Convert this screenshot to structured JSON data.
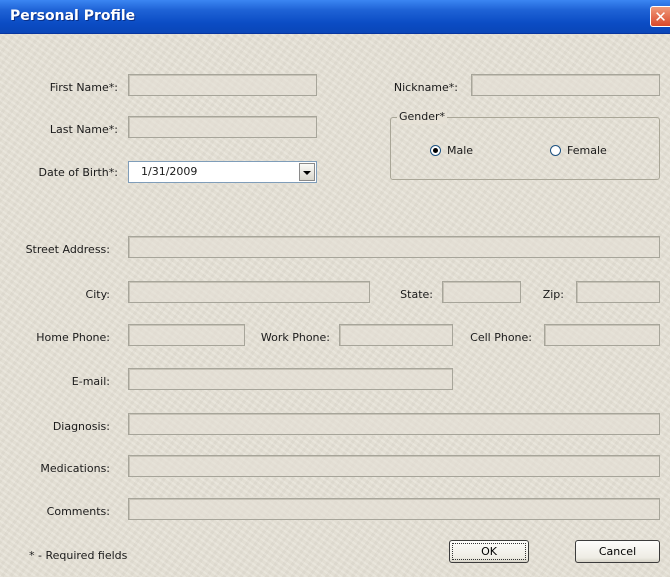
{
  "window": {
    "title": "Personal Profile",
    "close_glyph": "✕"
  },
  "form": {
    "first_name_label": "First Name*:",
    "last_name_label": "Last Name*:",
    "dob_label": "Date of Birth*:",
    "dob_value": "1/31/2009",
    "nickname_label": "Nickname*:",
    "gender_legend": "Gender*",
    "gender_male": "Male",
    "gender_female": "Female",
    "gender_selected": "Male",
    "street_label": "Street Address:",
    "city_label": "City:",
    "state_label": "State:",
    "zip_label": "Zip:",
    "home_phone_label": "Home Phone:",
    "work_phone_label": "Work Phone:",
    "cell_phone_label": "Cell Phone:",
    "email_label": "E-mail:",
    "diagnosis_label": "Diagnosis:",
    "medications_label": "Medications:",
    "comments_label": "Comments:"
  },
  "footer": {
    "required_note": "* - Required fields",
    "ok_label": "OK",
    "cancel_label": "Cancel"
  },
  "colors": {
    "titlebar": "#0a46b8",
    "window_bg": "#e6e1d6",
    "close_button": "#d9482a"
  }
}
